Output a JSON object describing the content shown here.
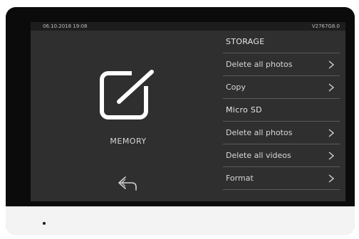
{
  "status": {
    "datetime": "06.10.2018 19:08",
    "version": "V2767G8.0"
  },
  "memory": {
    "label": "MEMORY",
    "icon": "edit-square-icon",
    "back_icon": "back-arrow-icon"
  },
  "menu": {
    "storage_title": "STORAGE",
    "storage_items": [
      "Delete all photos",
      "Copy"
    ],
    "sd_title": "Micro SD",
    "sd_items": [
      "Delete all photos",
      "Delete all videos",
      "Format"
    ]
  },
  "colors": {
    "screen_bg": "#2f2f2f",
    "text": "#d8d8d8",
    "divider": "#5a5a5a"
  }
}
